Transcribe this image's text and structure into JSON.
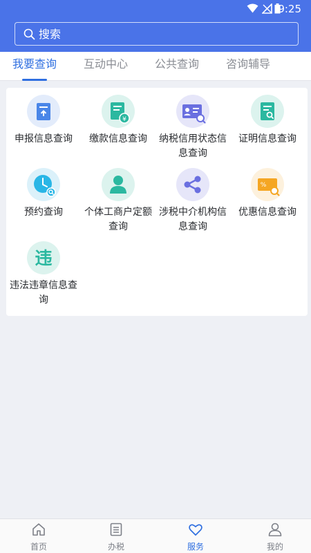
{
  "status": {
    "time": "9:25"
  },
  "search": {
    "placeholder": "搜索"
  },
  "tabs": [
    {
      "label": "我要查询",
      "active": true
    },
    {
      "label": "互动中心",
      "active": false
    },
    {
      "label": "公共查询",
      "active": false
    },
    {
      "label": "咨询辅导",
      "active": false
    }
  ],
  "grid": [
    {
      "label": "申报信息查询",
      "icon": "declaration-doc-icon",
      "color": "#4a86e8"
    },
    {
      "label": "缴款信息查询",
      "icon": "payment-doc-icon",
      "color": "#2bb8a0"
    },
    {
      "label": "纳税信用状态信息查询",
      "icon": "credit-card-search-icon",
      "color": "#6a6fe0"
    },
    {
      "label": "证明信息查询",
      "icon": "certificate-search-icon",
      "color": "#2bb8a0"
    },
    {
      "label": "预约查询",
      "icon": "clock-search-icon",
      "color": "#29b6e6"
    },
    {
      "label": "个体工商户定额查询",
      "icon": "person-icon",
      "color": "#2bb8a0"
    },
    {
      "label": "涉税中介机构信息查询",
      "icon": "share-network-icon",
      "color": "#6a6fe0"
    },
    {
      "label": "优惠信息查询",
      "icon": "discount-coupon-icon",
      "color": "#f5a623"
    },
    {
      "label": "违法违章信息查询",
      "icon": "violation-char-icon",
      "glyph": "违",
      "color": "#2bb8a0"
    }
  ],
  "bottom_nav": [
    {
      "label": "首页",
      "icon": "home-icon",
      "active": false
    },
    {
      "label": "办税",
      "icon": "list-icon",
      "active": false
    },
    {
      "label": "服务",
      "icon": "heart-icon",
      "active": true
    },
    {
      "label": "我的",
      "icon": "user-icon",
      "active": false
    }
  ]
}
